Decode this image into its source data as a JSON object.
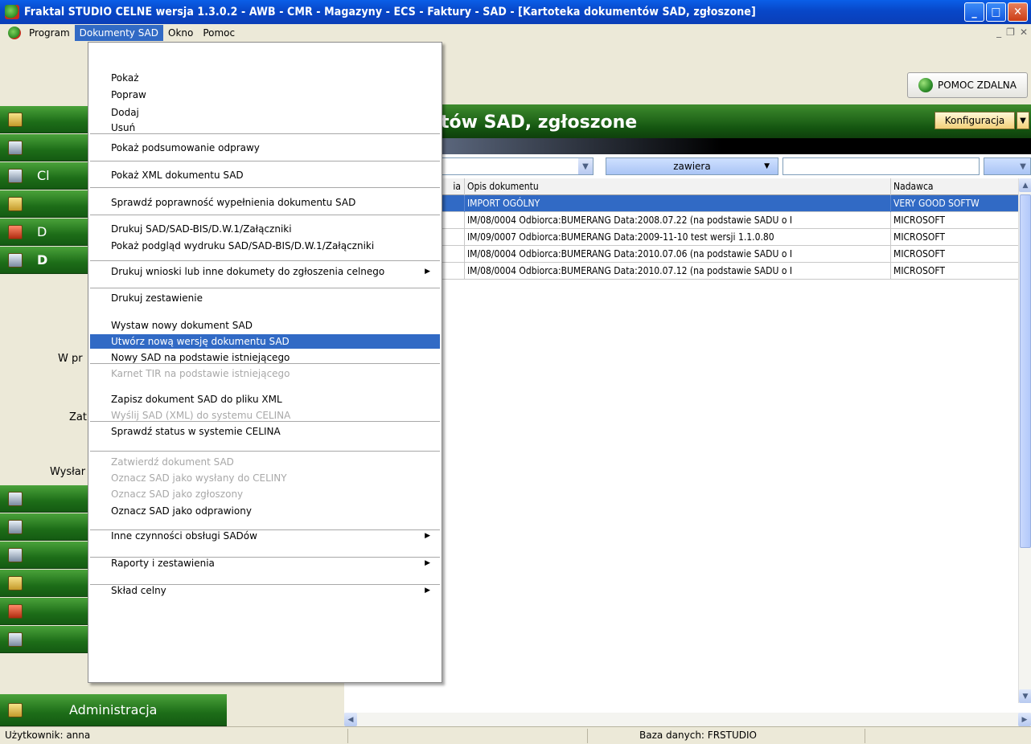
{
  "window": {
    "title": "Fraktal STUDIO CELNE  wersja 1.3.0.2 - AWB - CMR - Magazyny - ECS - Faktury - SAD - [Kartoteka dokumentów SAD, zgłoszone]"
  },
  "menubar": {
    "items": [
      "Program",
      "Dokumenty SAD",
      "Okno",
      "Pomoc"
    ]
  },
  "toolbar": {
    "remote_help_label": "POMOC ZDALNA"
  },
  "sidebar": {
    "partial_labels": [
      "Cl",
      "D",
      "D"
    ],
    "sub_labels": [
      "W pr",
      "Zat",
      "Wysłar"
    ],
    "admin_label": "Administracja"
  },
  "main": {
    "header_title": "tów SAD, zgłoszone",
    "config_label": "Konfiguracja",
    "filter": {
      "operator": "zawiera",
      "value": ""
    },
    "table": {
      "columns": [
        "ia",
        "Opis dokumentu",
        "Nadawca"
      ],
      "rows": [
        {
          "desc": "IMPORT OGÓLNY",
          "sender": "VERY GOOD SOFTW"
        },
        {
          "desc": "IM/08/0004 Odbiorca:BUMERANG Data:2008.07.22 (na podstawie SADU o I",
          "sender": "MICROSOFT"
        },
        {
          "desc": "IM/09/0007 Odbiorca:BUMERANG Data:2009-11-10 test wersji 1.1.0.80",
          "sender": "MICROSOFT"
        },
        {
          "desc": "IM/08/0004 Odbiorca:BUMERANG Data:2010.07.06 (na podstawie SADU o I",
          "sender": "MICROSOFT"
        },
        {
          "desc": "IM/08/0004 Odbiorca:BUMERANG Data:2010.07.12 (na podstawie SADU o I",
          "sender": "MICROSOFT"
        }
      ]
    }
  },
  "statusbar": {
    "user": "Użytkownik: anna",
    "db": "Baza danych: FRSTUDIO"
  },
  "dropdown": {
    "items": [
      {
        "label": "Pokaż",
        "state": "enabled"
      },
      {
        "label": "Popraw",
        "state": "enabled"
      },
      {
        "label": "Dodaj",
        "state": "enabled"
      },
      {
        "label": "Usuń",
        "state": "enabled"
      },
      {
        "label": "Pokaż podsumowanie odprawy",
        "state": "enabled"
      },
      {
        "label": "Pokaż XML dokumentu SAD",
        "state": "enabled"
      },
      {
        "label": "Sprawdź poprawność wypełnienia dokumentu SAD",
        "state": "enabled"
      },
      {
        "label": "Drukuj SAD/SAD-BIS/D.W.1/Załączniki",
        "state": "enabled"
      },
      {
        "label": "Pokaż podgląd wydruku SAD/SAD-BIS/D.W.1/Załączniki",
        "state": "enabled"
      },
      {
        "label": "Drukuj wnioski lub inne dokumety do zgłoszenia celnego",
        "state": "enabled",
        "submenu": true
      },
      {
        "label": "Drukuj zestawienie",
        "state": "enabled"
      },
      {
        "label": "Wystaw nowy dokument SAD",
        "state": "enabled"
      },
      {
        "label": "Utwórz nową wersję dokumentu SAD",
        "state": "highlighted"
      },
      {
        "label": "Nowy SAD na podstawie istniejącego",
        "state": "enabled"
      },
      {
        "label": "Karnet TIR na podstawie istniejącego",
        "state": "disabled"
      },
      {
        "label": "Zapisz dokument SAD do pliku XML",
        "state": "enabled"
      },
      {
        "label": "Wyślij SAD (XML) do systemu CELINA",
        "state": "disabled"
      },
      {
        "label": "Sprawdź status w systemie CELINA",
        "state": "enabled"
      },
      {
        "label": "Zatwierdź dokument SAD",
        "state": "disabled"
      },
      {
        "label": "Oznacz SAD jako wysłany do CELINY",
        "state": "disabled"
      },
      {
        "label": "Oznacz SAD jako zgłoszony",
        "state": "disabled"
      },
      {
        "label": "Oznacz SAD jako odprawiony",
        "state": "enabled"
      },
      {
        "label": "Inne czynności obsługi SADów",
        "state": "enabled",
        "submenu": true
      },
      {
        "label": "Raporty i zestawienia",
        "state": "enabled",
        "submenu": true
      },
      {
        "label": "Skład celny",
        "state": "enabled",
        "submenu": true
      }
    ]
  },
  "colors": {
    "titlebar": "#0847c8",
    "selection": "#316ac5",
    "sidebar_green": "#1d6d18",
    "config_button": "#f2d07a"
  }
}
